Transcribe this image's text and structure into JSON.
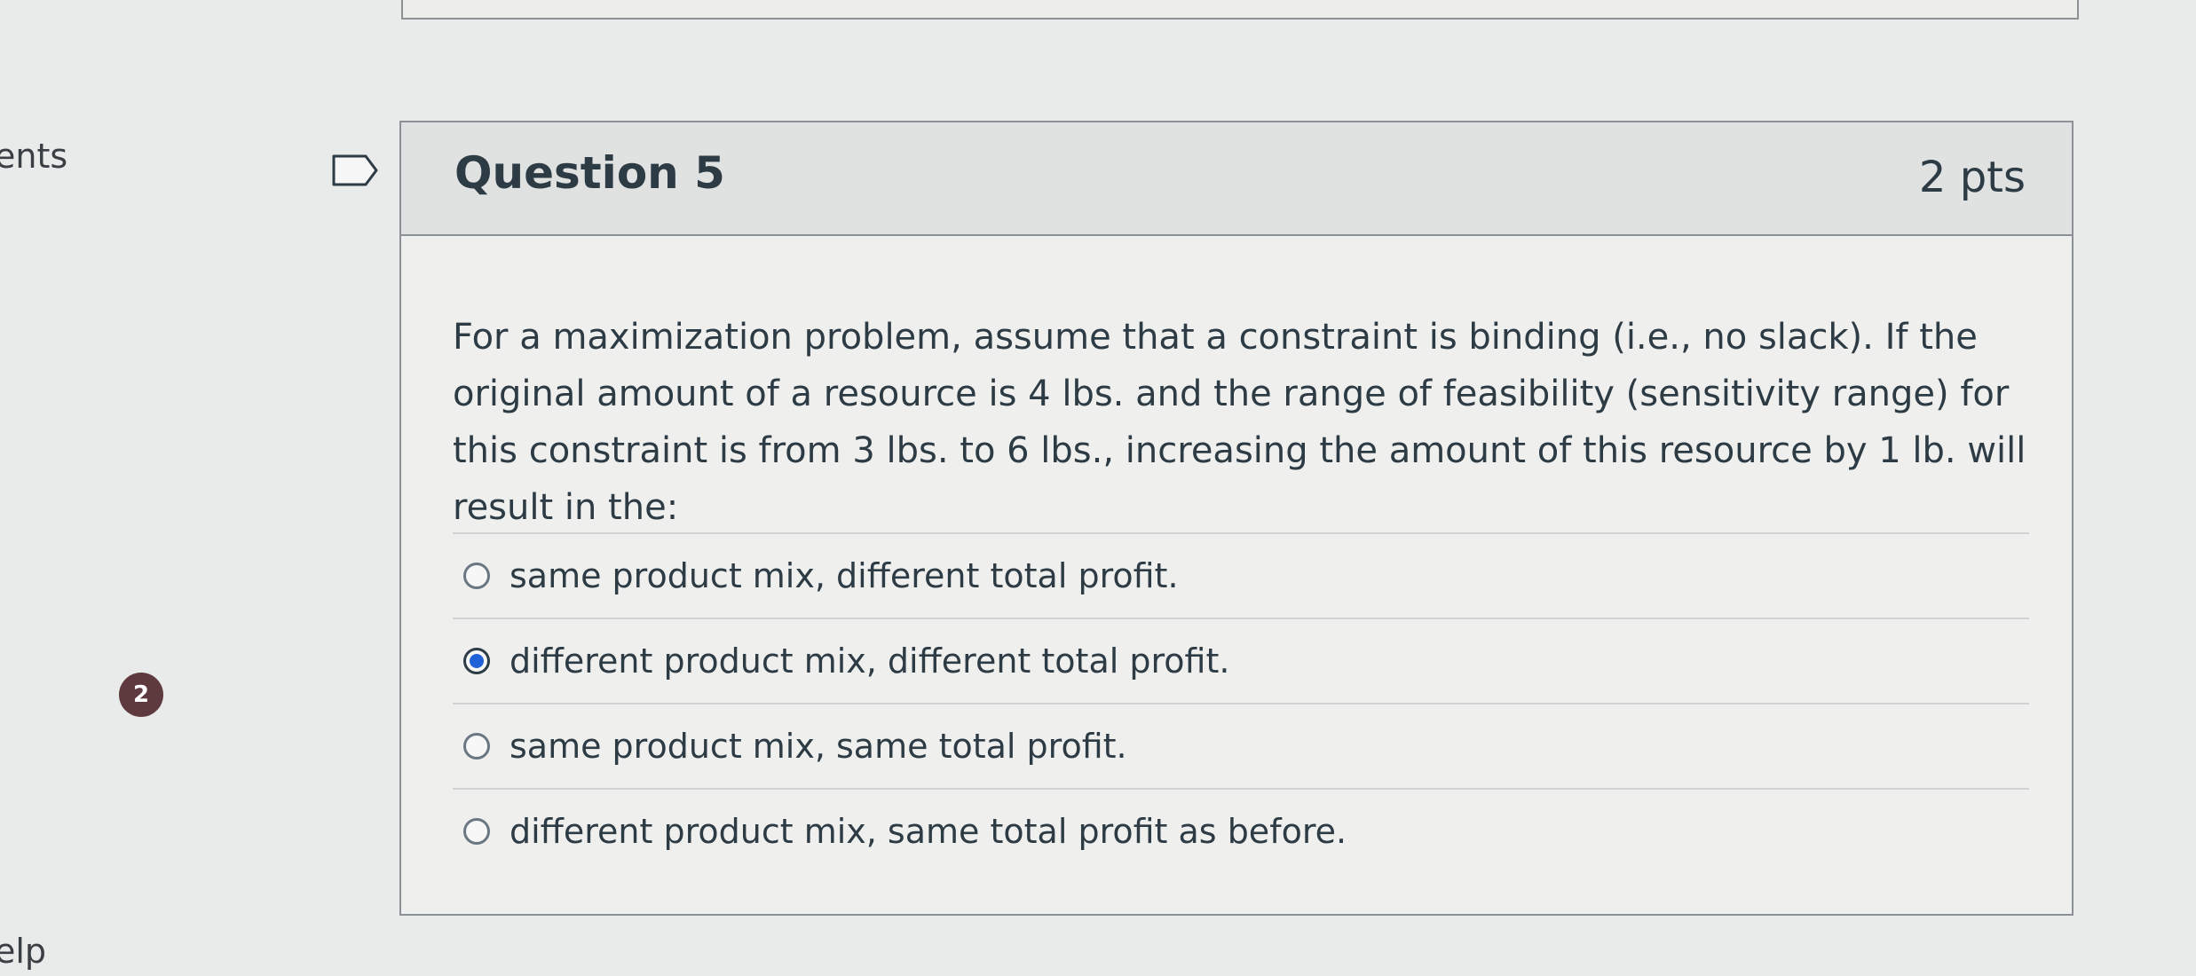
{
  "sidebar": {
    "comments_fragment": "ents",
    "help_fragment": "elp",
    "badge_count": "2"
  },
  "question": {
    "title": "Question 5",
    "points": "2 pts",
    "text": "For a maximization problem, assume that a constraint is binding (i.e., no slack). If the original amount of a resource is 4 lbs. and the range of feasibility (sensitivity range) for this constraint is from 3 lbs. to 6 lbs., increasing the amount of this resource by 1 lb. will result in the:",
    "answers": [
      {
        "label": "same product mix, different total profit.",
        "selected": false
      },
      {
        "label": "different product mix, different total profit.",
        "selected": true
      },
      {
        "label": "same product mix, same total profit.",
        "selected": false
      },
      {
        "label": "different product mix, same total profit as before.",
        "selected": false
      }
    ]
  },
  "colors": {
    "selected_radio": "#1f62d8",
    "badge": "#5e3a3f",
    "text": "#2d3b45"
  },
  "icons": {
    "flag": "flag-bookmark-icon"
  }
}
